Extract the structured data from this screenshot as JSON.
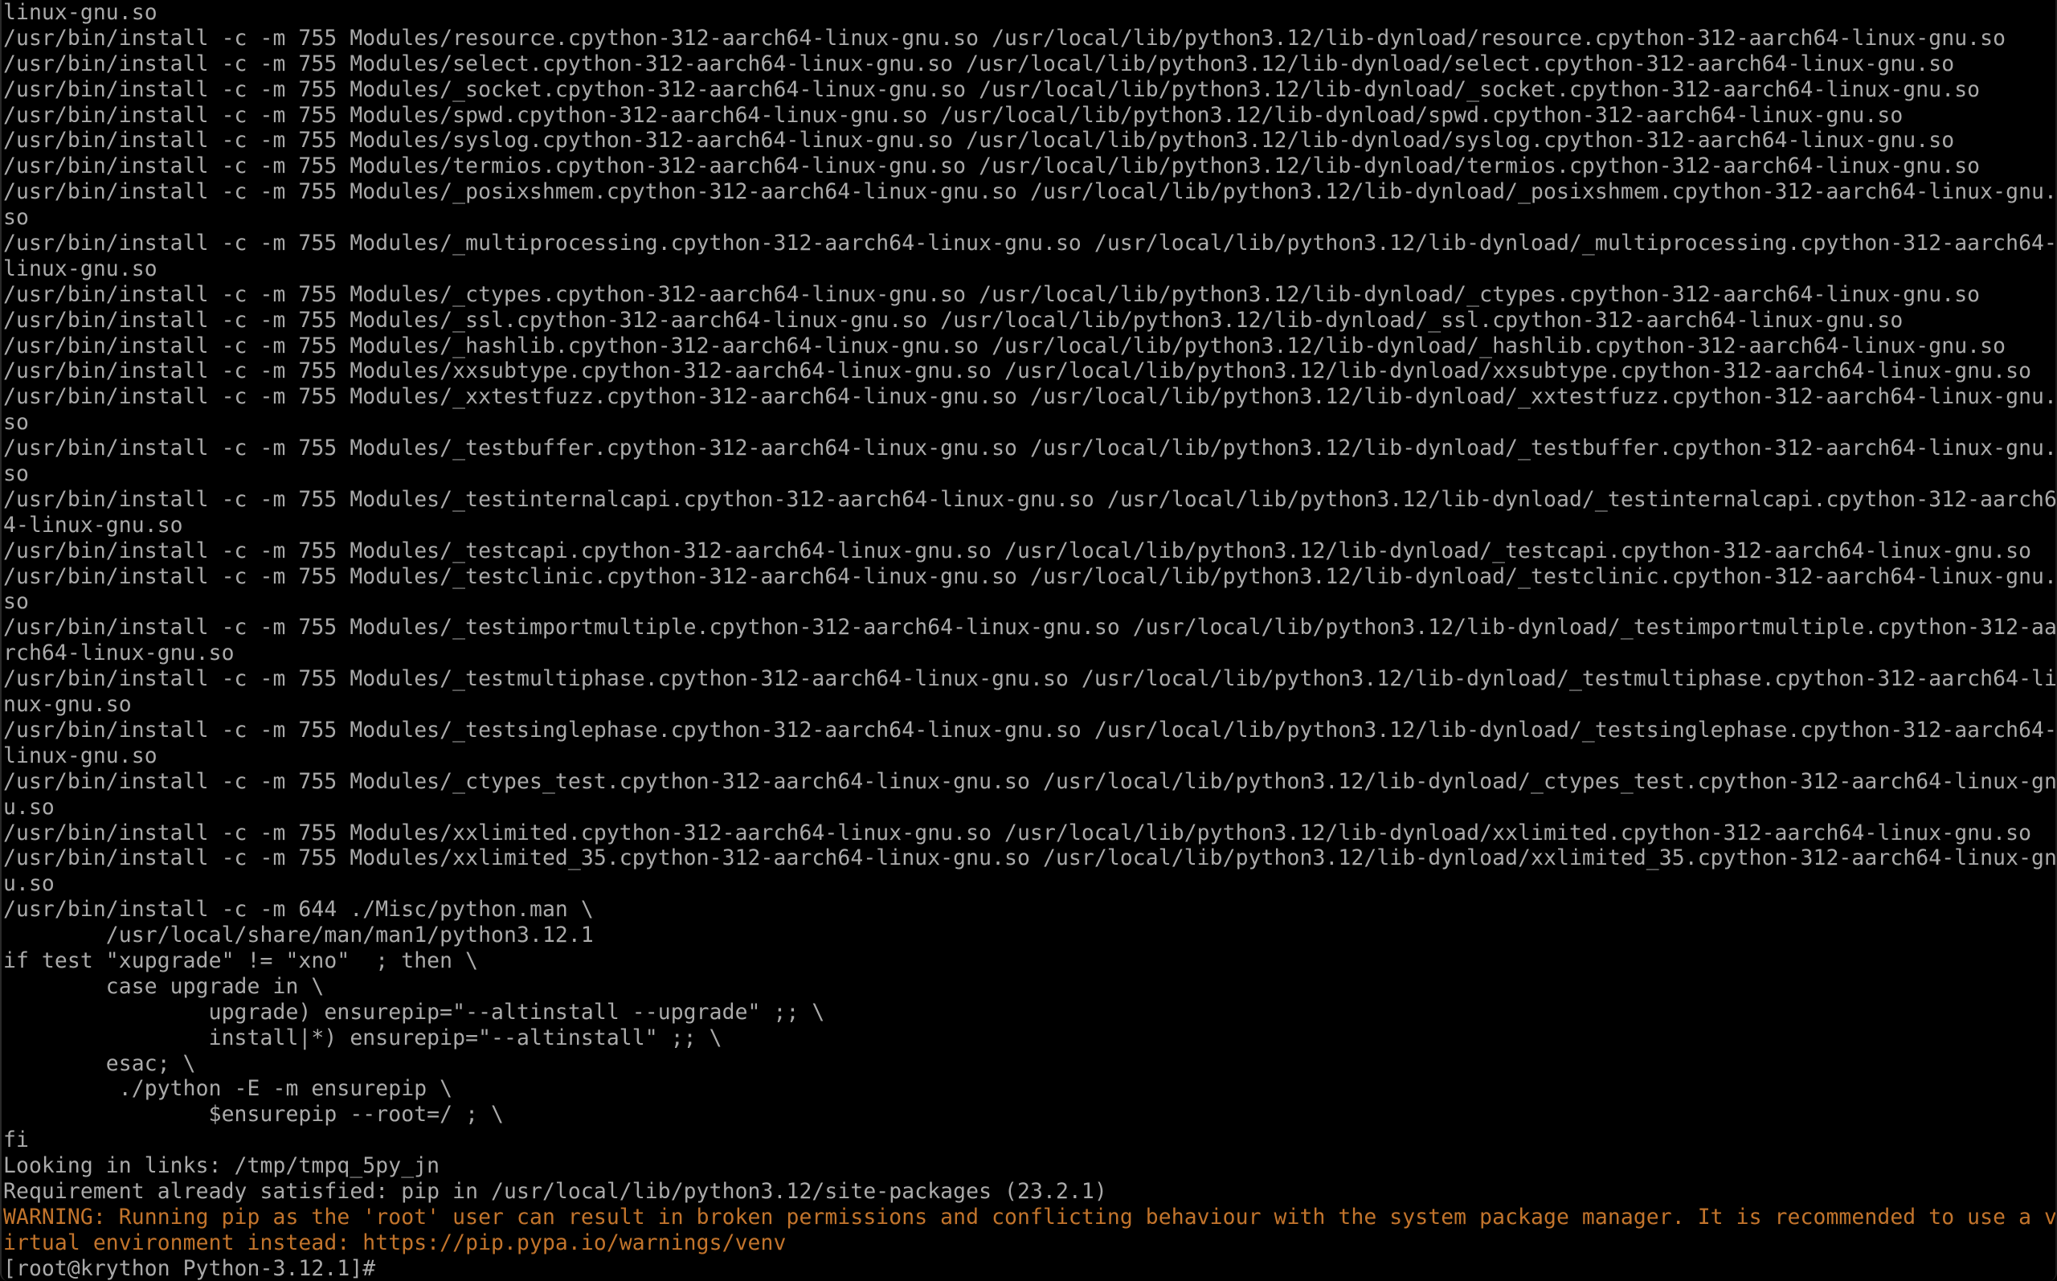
{
  "terminal": {
    "colors": {
      "background": "#000000",
      "foreground": "#aaaaaa",
      "warning": "#c2742c"
    },
    "lines": [
      {
        "text": "linux-gnu.so",
        "style": "normal"
      },
      {
        "text": "/usr/bin/install -c -m 755 Modules/resource.cpython-312-aarch64-linux-gnu.so /usr/local/lib/python3.12/lib-dynload/resource.cpython-312-aarch64-linux-gnu.so",
        "style": "normal"
      },
      {
        "text": "/usr/bin/install -c -m 755 Modules/select.cpython-312-aarch64-linux-gnu.so /usr/local/lib/python3.12/lib-dynload/select.cpython-312-aarch64-linux-gnu.so",
        "style": "normal"
      },
      {
        "text": "/usr/bin/install -c -m 755 Modules/_socket.cpython-312-aarch64-linux-gnu.so /usr/local/lib/python3.12/lib-dynload/_socket.cpython-312-aarch64-linux-gnu.so",
        "style": "normal"
      },
      {
        "text": "/usr/bin/install -c -m 755 Modules/spwd.cpython-312-aarch64-linux-gnu.so /usr/local/lib/python3.12/lib-dynload/spwd.cpython-312-aarch64-linux-gnu.so",
        "style": "normal"
      },
      {
        "text": "/usr/bin/install -c -m 755 Modules/syslog.cpython-312-aarch64-linux-gnu.so /usr/local/lib/python3.12/lib-dynload/syslog.cpython-312-aarch64-linux-gnu.so",
        "style": "normal"
      },
      {
        "text": "/usr/bin/install -c -m 755 Modules/termios.cpython-312-aarch64-linux-gnu.so /usr/local/lib/python3.12/lib-dynload/termios.cpython-312-aarch64-linux-gnu.so",
        "style": "normal"
      },
      {
        "text": "/usr/bin/install -c -m 755 Modules/_posixshmem.cpython-312-aarch64-linux-gnu.so /usr/local/lib/python3.12/lib-dynload/_posixshmem.cpython-312-aarch64-linux-gnu.",
        "style": "normal"
      },
      {
        "text": "so",
        "style": "normal"
      },
      {
        "text": "/usr/bin/install -c -m 755 Modules/_multiprocessing.cpython-312-aarch64-linux-gnu.so /usr/local/lib/python3.12/lib-dynload/_multiprocessing.cpython-312-aarch64-",
        "style": "normal"
      },
      {
        "text": "linux-gnu.so",
        "style": "normal"
      },
      {
        "text": "/usr/bin/install -c -m 755 Modules/_ctypes.cpython-312-aarch64-linux-gnu.so /usr/local/lib/python3.12/lib-dynload/_ctypes.cpython-312-aarch64-linux-gnu.so",
        "style": "normal"
      },
      {
        "text": "/usr/bin/install -c -m 755 Modules/_ssl.cpython-312-aarch64-linux-gnu.so /usr/local/lib/python3.12/lib-dynload/_ssl.cpython-312-aarch64-linux-gnu.so",
        "style": "normal"
      },
      {
        "text": "/usr/bin/install -c -m 755 Modules/_hashlib.cpython-312-aarch64-linux-gnu.so /usr/local/lib/python3.12/lib-dynload/_hashlib.cpython-312-aarch64-linux-gnu.so",
        "style": "normal"
      },
      {
        "text": "/usr/bin/install -c -m 755 Modules/xxsubtype.cpython-312-aarch64-linux-gnu.so /usr/local/lib/python3.12/lib-dynload/xxsubtype.cpython-312-aarch64-linux-gnu.so",
        "style": "normal"
      },
      {
        "text": "/usr/bin/install -c -m 755 Modules/_xxtestfuzz.cpython-312-aarch64-linux-gnu.so /usr/local/lib/python3.12/lib-dynload/_xxtestfuzz.cpython-312-aarch64-linux-gnu.",
        "style": "normal"
      },
      {
        "text": "so",
        "style": "normal"
      },
      {
        "text": "/usr/bin/install -c -m 755 Modules/_testbuffer.cpython-312-aarch64-linux-gnu.so /usr/local/lib/python3.12/lib-dynload/_testbuffer.cpython-312-aarch64-linux-gnu.",
        "style": "normal"
      },
      {
        "text": "so",
        "style": "normal"
      },
      {
        "text": "/usr/bin/install -c -m 755 Modules/_testinternalcapi.cpython-312-aarch64-linux-gnu.so /usr/local/lib/python3.12/lib-dynload/_testinternalcapi.cpython-312-aarch6",
        "style": "normal"
      },
      {
        "text": "4-linux-gnu.so",
        "style": "normal"
      },
      {
        "text": "/usr/bin/install -c -m 755 Modules/_testcapi.cpython-312-aarch64-linux-gnu.so /usr/local/lib/python3.12/lib-dynload/_testcapi.cpython-312-aarch64-linux-gnu.so",
        "style": "normal"
      },
      {
        "text": "/usr/bin/install -c -m 755 Modules/_testclinic.cpython-312-aarch64-linux-gnu.so /usr/local/lib/python3.12/lib-dynload/_testclinic.cpython-312-aarch64-linux-gnu.",
        "style": "normal"
      },
      {
        "text": "so",
        "style": "normal"
      },
      {
        "text": "/usr/bin/install -c -m 755 Modules/_testimportmultiple.cpython-312-aarch64-linux-gnu.so /usr/local/lib/python3.12/lib-dynload/_testimportmultiple.cpython-312-aa",
        "style": "normal"
      },
      {
        "text": "rch64-linux-gnu.so",
        "style": "normal"
      },
      {
        "text": "/usr/bin/install -c -m 755 Modules/_testmultiphase.cpython-312-aarch64-linux-gnu.so /usr/local/lib/python3.12/lib-dynload/_testmultiphase.cpython-312-aarch64-li",
        "style": "normal"
      },
      {
        "text": "nux-gnu.so",
        "style": "normal"
      },
      {
        "text": "/usr/bin/install -c -m 755 Modules/_testsinglephase.cpython-312-aarch64-linux-gnu.so /usr/local/lib/python3.12/lib-dynload/_testsinglephase.cpython-312-aarch64-",
        "style": "normal"
      },
      {
        "text": "linux-gnu.so",
        "style": "normal"
      },
      {
        "text": "/usr/bin/install -c -m 755 Modules/_ctypes_test.cpython-312-aarch64-linux-gnu.so /usr/local/lib/python3.12/lib-dynload/_ctypes_test.cpython-312-aarch64-linux-gn",
        "style": "normal"
      },
      {
        "text": "u.so",
        "style": "normal"
      },
      {
        "text": "/usr/bin/install -c -m 755 Modules/xxlimited.cpython-312-aarch64-linux-gnu.so /usr/local/lib/python3.12/lib-dynload/xxlimited.cpython-312-aarch64-linux-gnu.so",
        "style": "normal"
      },
      {
        "text": "/usr/bin/install -c -m 755 Modules/xxlimited_35.cpython-312-aarch64-linux-gnu.so /usr/local/lib/python3.12/lib-dynload/xxlimited_35.cpython-312-aarch64-linux-gn",
        "style": "normal"
      },
      {
        "text": "u.so",
        "style": "normal"
      },
      {
        "text": "/usr/bin/install -c -m 644 ./Misc/python.man \\",
        "style": "normal"
      },
      {
        "text": "        /usr/local/share/man/man1/python3.12.1",
        "style": "normal"
      },
      {
        "text": "if test \"xupgrade\" != \"xno\"  ; then \\",
        "style": "normal"
      },
      {
        "text": "        case upgrade in \\",
        "style": "normal"
      },
      {
        "text": "                upgrade) ensurepip=\"--altinstall --upgrade\" ;; \\",
        "style": "normal"
      },
      {
        "text": "                install|*) ensurepip=\"--altinstall\" ;; \\",
        "style": "normal"
      },
      {
        "text": "        esac; \\",
        "style": "normal"
      },
      {
        "text": "         ./python -E -m ensurepip \\",
        "style": "normal"
      },
      {
        "text": "                $ensurepip --root=/ ; \\",
        "style": "normal"
      },
      {
        "text": "fi",
        "style": "normal"
      },
      {
        "text": "Looking in links: /tmp/tmpq_5py_jn",
        "style": "normal"
      },
      {
        "text": "Requirement already satisfied: pip in /usr/local/lib/python3.12/site-packages (23.2.1)",
        "style": "normal"
      },
      {
        "text": "WARNING: Running pip as the 'root' user can result in broken permissions and conflicting behaviour with the system package manager. It is recommended to use a v",
        "style": "warn"
      },
      {
        "text": "irtual environment instead: https://pip.pypa.io/warnings/venv",
        "style": "warn"
      }
    ],
    "prompt": {
      "text": "[root@krython Python-3.12.1]#",
      "input_value": ""
    }
  }
}
